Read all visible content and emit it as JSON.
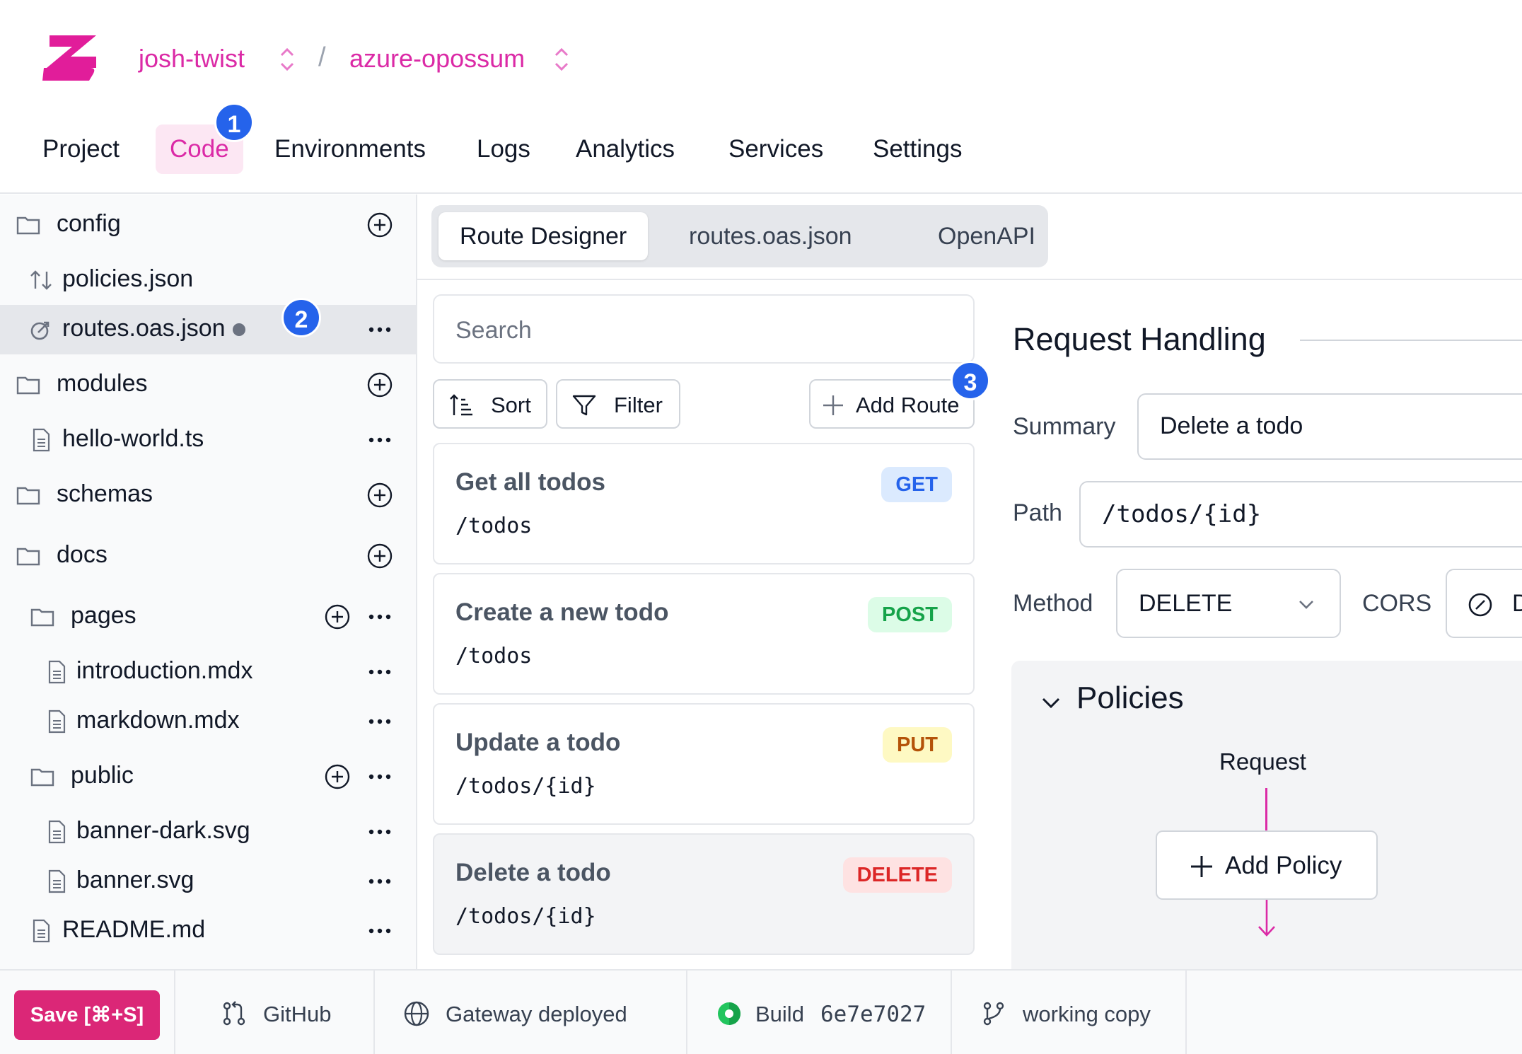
{
  "header": {
    "org": "josh-twist",
    "separator": "/",
    "project": "azure-opossum",
    "tabs": [
      {
        "label": "Project"
      },
      {
        "label": "Code"
      },
      {
        "label": "Environments"
      },
      {
        "label": "Logs"
      },
      {
        "label": "Analytics"
      },
      {
        "label": "Services"
      },
      {
        "label": "Settings"
      }
    ],
    "active_tab": "Code"
  },
  "badges": {
    "one": "1",
    "two": "2",
    "three": "3"
  },
  "sidebar": {
    "items": [
      {
        "label": "config"
      },
      {
        "label": "policies.json"
      },
      {
        "label": "routes.oas.json"
      },
      {
        "label": "modules"
      },
      {
        "label": "hello-world.ts"
      },
      {
        "label": "schemas"
      },
      {
        "label": "docs"
      },
      {
        "label": "pages"
      },
      {
        "label": "introduction.mdx"
      },
      {
        "label": "markdown.mdx"
      },
      {
        "label": "public"
      },
      {
        "label": "banner-dark.svg"
      },
      {
        "label": "banner.svg"
      },
      {
        "label": "README.md"
      }
    ],
    "selected": "routes.oas.json"
  },
  "editor_tabs": [
    {
      "label": "Route Designer"
    },
    {
      "label": "routes.oas.json"
    },
    {
      "label": "OpenAPI"
    }
  ],
  "route_list": {
    "search_placeholder": "Search",
    "sort_label": "Sort",
    "filter_label": "Filter",
    "add_route_label": "Add Route",
    "routes": [
      {
        "title": "Get all todos",
        "path": "/todos",
        "method": "GET"
      },
      {
        "title": "Create a new todo",
        "path": "/todos",
        "method": "POST"
      },
      {
        "title": "Update a todo",
        "path": "/todos/{id}",
        "method": "PUT"
      },
      {
        "title": "Delete a todo",
        "path": "/todos/{id}",
        "method": "DELETE"
      }
    ]
  },
  "detail": {
    "title": "Request Handling",
    "summary_label": "Summary",
    "summary_value": "Delete a todo",
    "path_label": "Path",
    "path_value": "/todos/{id}",
    "method_label": "Method",
    "method_value": "DELETE",
    "cors_label": "CORS",
    "cors_value": "D",
    "policies_title": "Policies",
    "request_label": "Request",
    "add_policy_label": "Add Policy"
  },
  "footer": {
    "save_label": "Save [⌘+S]",
    "github_label": "GitHub",
    "gateway_label": "Gateway deployed",
    "build_label": "Build",
    "build_hash": "6e7e7027",
    "branch_label": "working copy"
  },
  "colors": {
    "brand": "#db2aa6",
    "save": "#db2777",
    "badge": "#2563eb",
    "build_ok": "#22c55e"
  }
}
